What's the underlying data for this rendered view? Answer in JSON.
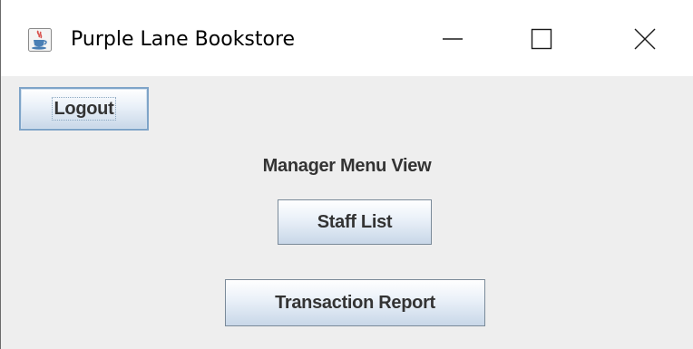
{
  "window": {
    "title": "Purple Lane Bookstore",
    "icon": "java-coffee-cup-icon",
    "controls": {
      "minimize_icon": "minimize-icon",
      "maximize_icon": "maximize-icon",
      "close_icon": "close-icon"
    }
  },
  "toolbar": {
    "logout_label": "Logout"
  },
  "main": {
    "heading": "Manager Menu View",
    "staff_list_label": "Staff List",
    "transaction_report_label": "Transaction Report"
  },
  "colors": {
    "panel_background": "#eeeeee",
    "button_border": "#7a8a99",
    "focus_border": "#7ea4c8",
    "text": "#333333"
  }
}
